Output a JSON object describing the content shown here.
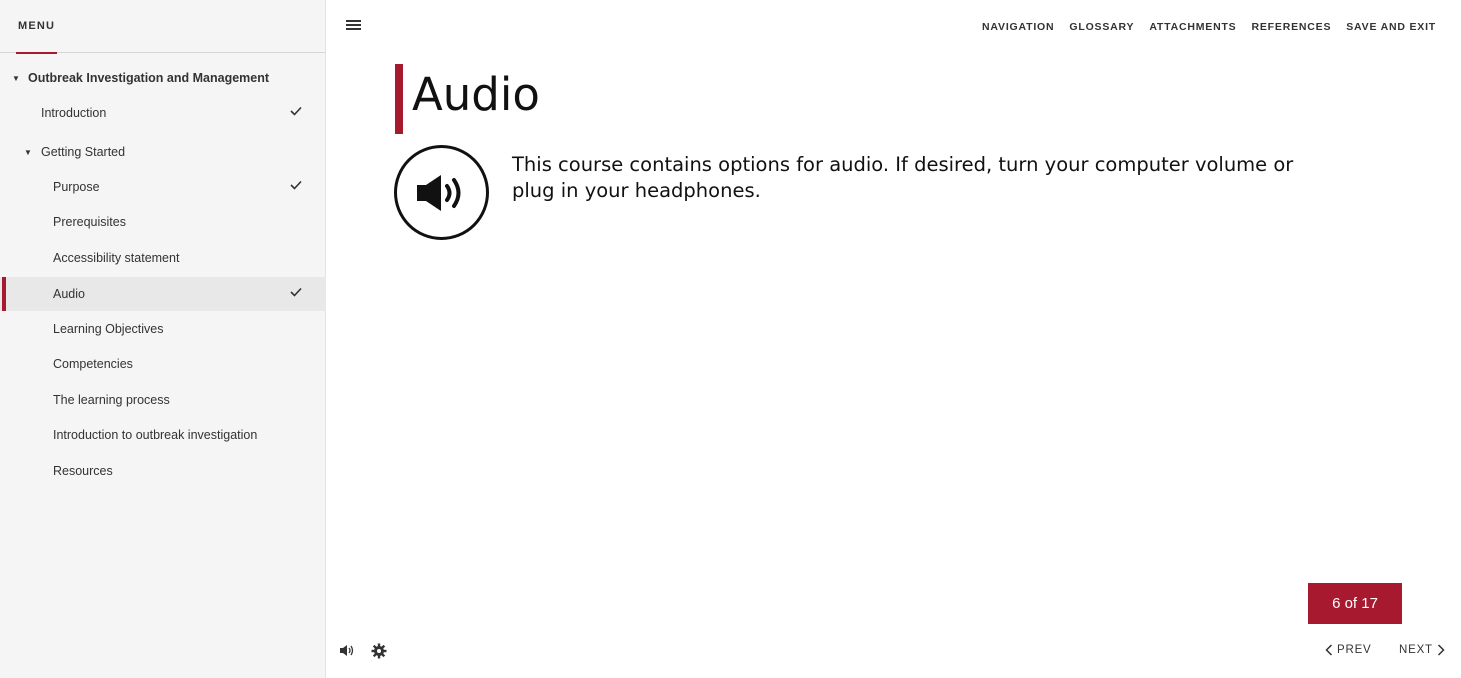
{
  "sidebar": {
    "menu_label": "MENU",
    "items": [
      {
        "label": "Outbreak Investigation and Management",
        "expanded": true,
        "checked": false
      },
      {
        "label": "Introduction",
        "checked": true
      },
      {
        "label": "Getting Started",
        "expanded": true,
        "checked": false
      },
      {
        "label": "Purpose",
        "checked": true
      },
      {
        "label": "Prerequisites",
        "checked": false
      },
      {
        "label": "Accessibility statement",
        "checked": false
      },
      {
        "label": "Audio",
        "checked": true,
        "active": true
      },
      {
        "label": "Learning Objectives",
        "checked": false
      },
      {
        "label": "Competencies",
        "checked": false
      },
      {
        "label": "The learning process",
        "checked": false
      },
      {
        "label": "Introduction to outbreak investigation",
        "checked": false
      },
      {
        "label": "Resources",
        "checked": false
      }
    ]
  },
  "topnav": {
    "navigation": "NAVIGATION",
    "glossary": "GLOSSARY",
    "attachments": "ATTACHMENTS",
    "references": "REFERENCES",
    "save_exit": "SAVE AND EXIT"
  },
  "main": {
    "title": "Audio",
    "body": "This course contains options for audio. If desired, turn your computer volume or plug in your headphones."
  },
  "footer": {
    "page_count": "6 of 17",
    "prev": "PREV",
    "next": "NEXT"
  },
  "colors": {
    "accent": "#a6192e"
  },
  "icons": [
    "hamburger-icon",
    "checkmark-icon",
    "speaker-icon",
    "gear-icon",
    "chevron-left-icon",
    "chevron-right-icon"
  ]
}
